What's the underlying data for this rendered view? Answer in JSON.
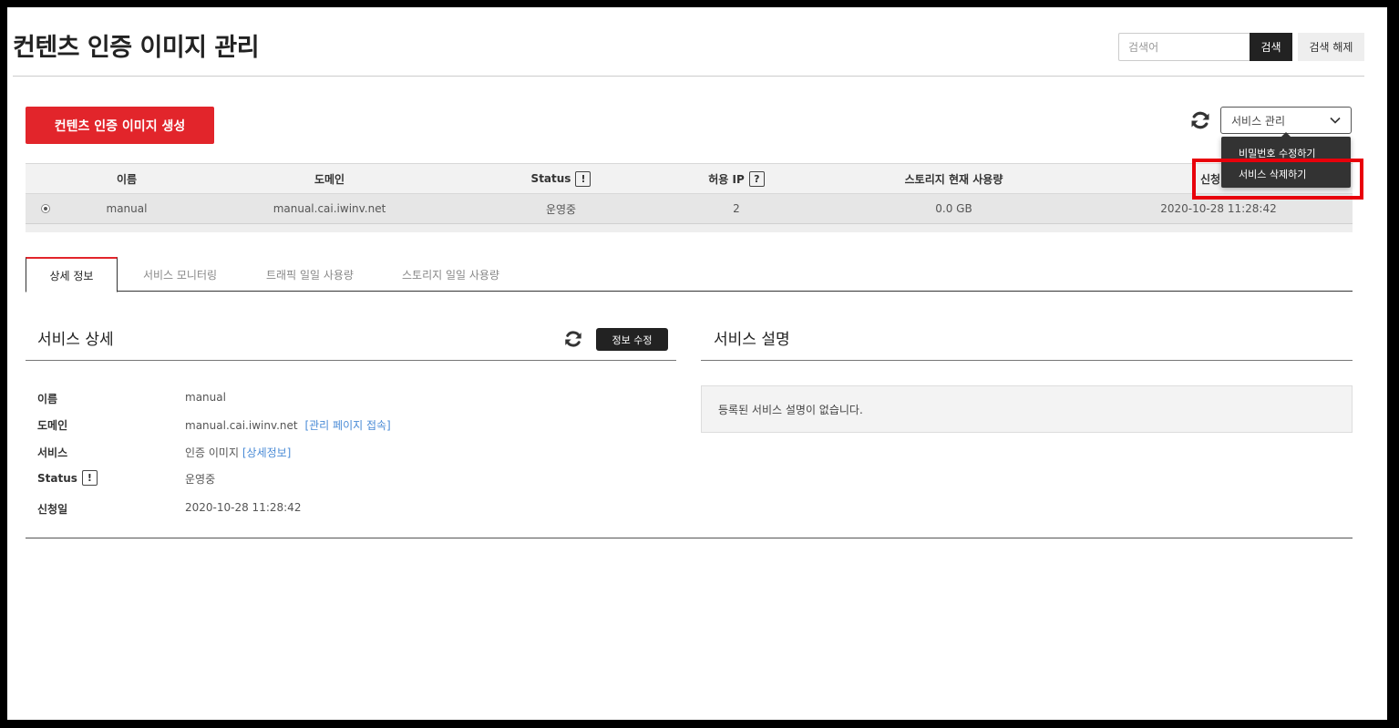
{
  "page": {
    "title": "컨텐츠 인증 이미지 관리"
  },
  "search": {
    "placeholder": "검색어",
    "button": "검색",
    "reset": "검색 해제"
  },
  "toolbar": {
    "create_label": "컨텐츠 인증 이미지 생성",
    "service_menu_label": "서비스 관리"
  },
  "dropdown": {
    "items": [
      "비밀번호 수정하기",
      "서비스 삭제하기"
    ]
  },
  "table": {
    "headers": {
      "name": "이름",
      "domain": "도메인",
      "status": "Status",
      "allowed_ip": "허용 IP",
      "storage": "스토리지 현재 사용량",
      "applied": "신청"
    },
    "rows": [
      {
        "name": "manual",
        "domain": "manual.cai.iwinv.net",
        "status": "운영중",
        "allowed_ip": "2",
        "storage": "0.0 GB",
        "applied": "2020-10-28 11:28:42"
      }
    ]
  },
  "tabs": [
    "상세 정보",
    "서비스 모니터링",
    "트래픽 일일 사용량",
    "스토리지 일일 사용량"
  ],
  "detail": {
    "title": "서비스 상세",
    "edit_label": "정보 수정",
    "labels": {
      "name": "이름",
      "domain": "도메인",
      "service": "서비스",
      "status": "Status",
      "applied": "신청일"
    },
    "values": {
      "name": "manual",
      "domain": "manual.cai.iwinv.net",
      "domain_link": "[관리 페이지 접속]",
      "service": "인증 이미지",
      "service_link": "[상세정보]",
      "status": "운영중",
      "applied": "2020-10-28 11:28:42"
    }
  },
  "description": {
    "title": "서비스 설명",
    "empty_text": "등록된 서비스 설명이 없습니다."
  },
  "help_icons": {
    "exclamation": "!",
    "question": "?"
  },
  "colors": {
    "accent": "#e2252b",
    "link": "#4a8bd6",
    "dark": "#222222",
    "highlight": "#e8000b"
  }
}
